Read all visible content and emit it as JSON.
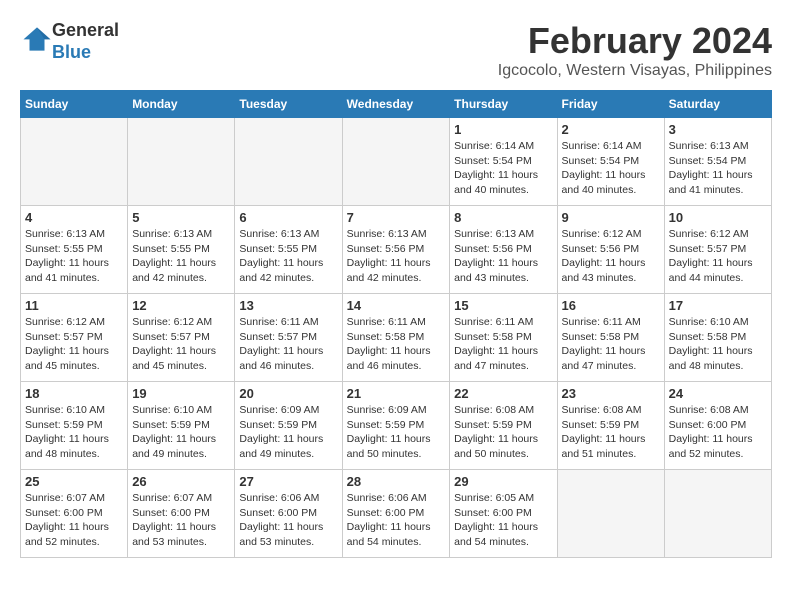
{
  "header": {
    "logo_line1": "General",
    "logo_line2": "Blue",
    "month_year": "February 2024",
    "location": "Igcocolo, Western Visayas, Philippines"
  },
  "columns": [
    "Sunday",
    "Monday",
    "Tuesday",
    "Wednesday",
    "Thursday",
    "Friday",
    "Saturday"
  ],
  "weeks": [
    [
      {
        "day": "",
        "info": ""
      },
      {
        "day": "",
        "info": ""
      },
      {
        "day": "",
        "info": ""
      },
      {
        "day": "",
        "info": ""
      },
      {
        "day": "1",
        "info": "Sunrise: 6:14 AM\nSunset: 5:54 PM\nDaylight: 11 hours\nand 40 minutes."
      },
      {
        "day": "2",
        "info": "Sunrise: 6:14 AM\nSunset: 5:54 PM\nDaylight: 11 hours\nand 40 minutes."
      },
      {
        "day": "3",
        "info": "Sunrise: 6:13 AM\nSunset: 5:54 PM\nDaylight: 11 hours\nand 41 minutes."
      }
    ],
    [
      {
        "day": "4",
        "info": "Sunrise: 6:13 AM\nSunset: 5:55 PM\nDaylight: 11 hours\nand 41 minutes."
      },
      {
        "day": "5",
        "info": "Sunrise: 6:13 AM\nSunset: 5:55 PM\nDaylight: 11 hours\nand 42 minutes."
      },
      {
        "day": "6",
        "info": "Sunrise: 6:13 AM\nSunset: 5:55 PM\nDaylight: 11 hours\nand 42 minutes."
      },
      {
        "day": "7",
        "info": "Sunrise: 6:13 AM\nSunset: 5:56 PM\nDaylight: 11 hours\nand 42 minutes."
      },
      {
        "day": "8",
        "info": "Sunrise: 6:13 AM\nSunset: 5:56 PM\nDaylight: 11 hours\nand 43 minutes."
      },
      {
        "day": "9",
        "info": "Sunrise: 6:12 AM\nSunset: 5:56 PM\nDaylight: 11 hours\nand 43 minutes."
      },
      {
        "day": "10",
        "info": "Sunrise: 6:12 AM\nSunset: 5:57 PM\nDaylight: 11 hours\nand 44 minutes."
      }
    ],
    [
      {
        "day": "11",
        "info": "Sunrise: 6:12 AM\nSunset: 5:57 PM\nDaylight: 11 hours\nand 45 minutes."
      },
      {
        "day": "12",
        "info": "Sunrise: 6:12 AM\nSunset: 5:57 PM\nDaylight: 11 hours\nand 45 minutes."
      },
      {
        "day": "13",
        "info": "Sunrise: 6:11 AM\nSunset: 5:57 PM\nDaylight: 11 hours\nand 46 minutes."
      },
      {
        "day": "14",
        "info": "Sunrise: 6:11 AM\nSunset: 5:58 PM\nDaylight: 11 hours\nand 46 minutes."
      },
      {
        "day": "15",
        "info": "Sunrise: 6:11 AM\nSunset: 5:58 PM\nDaylight: 11 hours\nand 47 minutes."
      },
      {
        "day": "16",
        "info": "Sunrise: 6:11 AM\nSunset: 5:58 PM\nDaylight: 11 hours\nand 47 minutes."
      },
      {
        "day": "17",
        "info": "Sunrise: 6:10 AM\nSunset: 5:58 PM\nDaylight: 11 hours\nand 48 minutes."
      }
    ],
    [
      {
        "day": "18",
        "info": "Sunrise: 6:10 AM\nSunset: 5:59 PM\nDaylight: 11 hours\nand 48 minutes."
      },
      {
        "day": "19",
        "info": "Sunrise: 6:10 AM\nSunset: 5:59 PM\nDaylight: 11 hours\nand 49 minutes."
      },
      {
        "day": "20",
        "info": "Sunrise: 6:09 AM\nSunset: 5:59 PM\nDaylight: 11 hours\nand 49 minutes."
      },
      {
        "day": "21",
        "info": "Sunrise: 6:09 AM\nSunset: 5:59 PM\nDaylight: 11 hours\nand 50 minutes."
      },
      {
        "day": "22",
        "info": "Sunrise: 6:08 AM\nSunset: 5:59 PM\nDaylight: 11 hours\nand 50 minutes."
      },
      {
        "day": "23",
        "info": "Sunrise: 6:08 AM\nSunset: 5:59 PM\nDaylight: 11 hours\nand 51 minutes."
      },
      {
        "day": "24",
        "info": "Sunrise: 6:08 AM\nSunset: 6:00 PM\nDaylight: 11 hours\nand 52 minutes."
      }
    ],
    [
      {
        "day": "25",
        "info": "Sunrise: 6:07 AM\nSunset: 6:00 PM\nDaylight: 11 hours\nand 52 minutes."
      },
      {
        "day": "26",
        "info": "Sunrise: 6:07 AM\nSunset: 6:00 PM\nDaylight: 11 hours\nand 53 minutes."
      },
      {
        "day": "27",
        "info": "Sunrise: 6:06 AM\nSunset: 6:00 PM\nDaylight: 11 hours\nand 53 minutes."
      },
      {
        "day": "28",
        "info": "Sunrise: 6:06 AM\nSunset: 6:00 PM\nDaylight: 11 hours\nand 54 minutes."
      },
      {
        "day": "29",
        "info": "Sunrise: 6:05 AM\nSunset: 6:00 PM\nDaylight: 11 hours\nand 54 minutes."
      },
      {
        "day": "",
        "info": ""
      },
      {
        "day": "",
        "info": ""
      }
    ]
  ]
}
